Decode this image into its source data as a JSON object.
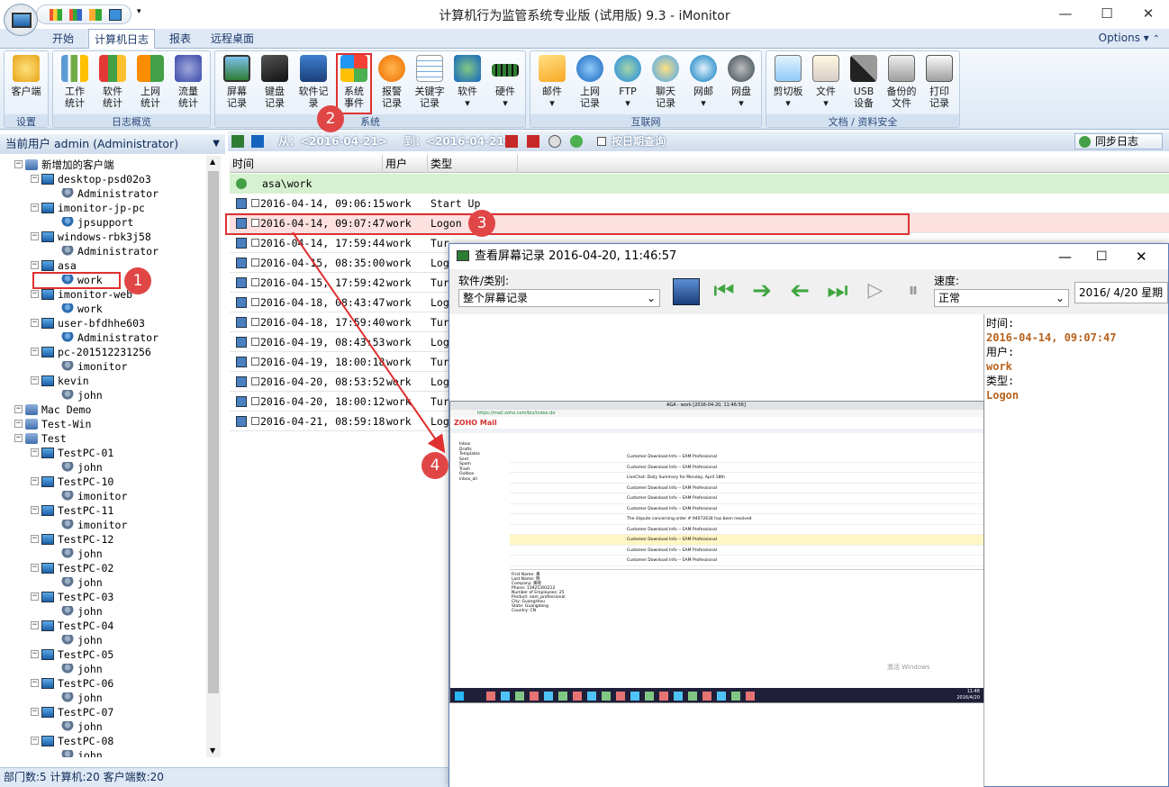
{
  "window": {
    "title": "计算机行为监管系统专业版 (试用版) 9.3 - iMonitor",
    "minimize": "—",
    "maximize": "☐",
    "close": "✕"
  },
  "qat": {
    "dropdown": "▾"
  },
  "ribbon_tabs": [
    {
      "label": "开始"
    },
    {
      "label": "计算机日志"
    },
    {
      "label": "报表"
    },
    {
      "label": "远程桌面"
    }
  ],
  "options_label": "Options",
  "ribbon_groups": [
    {
      "label": "设置",
      "buttons": [
        {
          "label": "客户端"
        }
      ]
    },
    {
      "label": "日志概览",
      "buttons": [
        {
          "label": "工作\n统计"
        },
        {
          "label": "软件\n统计"
        },
        {
          "label": "上网\n统计"
        },
        {
          "label": "流量\n统计"
        }
      ]
    },
    {
      "label": "系统",
      "buttons": [
        {
          "label": "屏幕\n记录"
        },
        {
          "label": "键盘\n记录"
        },
        {
          "label": "软件记录"
        },
        {
          "label": "系统\n事件"
        },
        {
          "label": "报警\n记录"
        },
        {
          "label": "关键字\n记录"
        },
        {
          "label": "软件"
        },
        {
          "label": "硬件"
        }
      ]
    },
    {
      "label": "互联网",
      "buttons": [
        {
          "label": "邮件"
        },
        {
          "label": "上网\n记录"
        },
        {
          "label": "FTP"
        },
        {
          "label": "聊天\n记录"
        },
        {
          "label": "网邮"
        },
        {
          "label": "网盘"
        }
      ]
    },
    {
      "label": "文档 / 资料安全",
      "buttons": [
        {
          "label": "剪切板"
        },
        {
          "label": "文件"
        },
        {
          "label": "USB\n设备"
        },
        {
          "label": "备份的\n文件"
        },
        {
          "label": "打印\n记录"
        }
      ]
    }
  ],
  "left_panel": {
    "current_user": "当前用户 admin (Administrator)",
    "tree": [
      {
        "label": "新增加的客户端",
        "type": "group",
        "level": 0
      },
      {
        "label": "desktop-psd02o3",
        "type": "pc",
        "level": 1
      },
      {
        "label": "Administrator",
        "type": "admin",
        "level": 2
      },
      {
        "label": "imonitor-jp-pc",
        "type": "pc",
        "level": 1
      },
      {
        "label": "jpsupport",
        "type": "user",
        "level": 2
      },
      {
        "label": "windows-rbk3j58",
        "type": "pc",
        "level": 1
      },
      {
        "label": "Administrator",
        "type": "admin",
        "level": 2
      },
      {
        "label": "asa",
        "type": "pc",
        "level": 1
      },
      {
        "label": "work",
        "type": "user",
        "level": 2
      },
      {
        "label": "imonitor-web",
        "type": "pc",
        "level": 1
      },
      {
        "label": "work",
        "type": "user",
        "level": 2
      },
      {
        "label": "user-bfdhhe603",
        "type": "pc",
        "level": 1
      },
      {
        "label": "Administrator",
        "type": "user",
        "level": 2
      },
      {
        "label": "pc-201512231256",
        "type": "pc",
        "level": 1
      },
      {
        "label": "imonitor",
        "type": "admin",
        "level": 2
      },
      {
        "label": "kevin",
        "type": "pc",
        "level": 1
      },
      {
        "label": "john",
        "type": "admin",
        "level": 2
      },
      {
        "label": "Mac Demo",
        "type": "group",
        "level": 0
      },
      {
        "label": "Test-Win",
        "type": "group",
        "level": 0
      },
      {
        "label": "Test",
        "type": "group",
        "level": 0
      },
      {
        "label": "TestPC-01",
        "type": "pc",
        "level": 1
      },
      {
        "label": "john",
        "type": "admin",
        "level": 2
      },
      {
        "label": "TestPC-10",
        "type": "pc",
        "level": 1
      },
      {
        "label": "imonitor",
        "type": "admin",
        "level": 2
      },
      {
        "label": "TestPC-11",
        "type": "pc",
        "level": 1
      },
      {
        "label": "imonitor",
        "type": "admin",
        "level": 2
      },
      {
        "label": "TestPC-12",
        "type": "pc",
        "level": 1
      },
      {
        "label": "john",
        "type": "admin",
        "level": 2
      },
      {
        "label": "TestPC-02",
        "type": "pc",
        "level": 1
      },
      {
        "label": "john",
        "type": "admin",
        "level": 2
      },
      {
        "label": "TestPC-03",
        "type": "pc",
        "level": 1
      },
      {
        "label": "john",
        "type": "admin",
        "level": 2
      },
      {
        "label": "TestPC-04",
        "type": "pc",
        "level": 1
      },
      {
        "label": "john",
        "type": "admin",
        "level": 2
      },
      {
        "label": "TestPC-05",
        "type": "pc",
        "level": 1
      },
      {
        "label": "john",
        "type": "admin",
        "level": 2
      },
      {
        "label": "TestPC-06",
        "type": "pc",
        "level": 1
      },
      {
        "label": "john",
        "type": "admin",
        "level": 2
      },
      {
        "label": "TestPC-07",
        "type": "pc",
        "level": 1
      },
      {
        "label": "john",
        "type": "admin",
        "level": 2
      },
      {
        "label": "TestPC-08",
        "type": "pc",
        "level": 1
      },
      {
        "label": "john",
        "type": "admin",
        "level": 2
      }
    ]
  },
  "status_bar": "部门数:5 计算机:20 客户端数:20",
  "main_toolbar": {
    "range_from": "从：<2016-04-21>",
    "range_to": "到：<2016-04-21>",
    "date_query": "按日期查询",
    "sync": "同步日志"
  },
  "columns": [
    {
      "label": "时间"
    },
    {
      "label": "用户"
    },
    {
      "label": "类型"
    }
  ],
  "group_row": "asa\\work",
  "rows": [
    {
      "time": "2016-04-14, 09:06:15",
      "user": "work",
      "type": "Start Up"
    },
    {
      "time": "2016-04-14, 09:07:47",
      "user": "work",
      "type": "Logon"
    },
    {
      "time": "2016-04-14, 17:59:44",
      "user": "work",
      "type": "Tur"
    },
    {
      "time": "2016-04-15, 08:35:00",
      "user": "work",
      "type": "Log"
    },
    {
      "time": "2016-04-15, 17:59:42",
      "user": "work",
      "type": "Tur"
    },
    {
      "time": "2016-04-18, 08:43:47",
      "user": "work",
      "type": "Log"
    },
    {
      "time": "2016-04-18, 17:59:40",
      "user": "work",
      "type": "Tur"
    },
    {
      "time": "2016-04-19, 08:43:53",
      "user": "work",
      "type": "Log"
    },
    {
      "time": "2016-04-19, 18:00:18",
      "user": "work",
      "type": "Tur"
    },
    {
      "time": "2016-04-20, 08:53:52",
      "user": "work",
      "type": "Log"
    },
    {
      "time": "2016-04-20, 18:00:12",
      "user": "work",
      "type": "Tur"
    },
    {
      "time": "2016-04-21, 08:59:18",
      "user": "work",
      "type": "Log"
    }
  ],
  "dialog": {
    "title": "查看屏幕记录 2016-04-20, 11:46:57",
    "software_label": "软件/类别:",
    "software_value": "整个屏幕记录",
    "speed_label": "速度:",
    "speed_value": "正常",
    "date_value": "2016/ 4/20 星期",
    "info": {
      "time_label": "时间:",
      "time_value": "2016-04-14, 09:07:47",
      "user_label": "用户:",
      "user_value": "work",
      "type_label": "类型:",
      "type_value": "Logon"
    },
    "screenshot": {
      "window_title": "AGA - work [2016-04-20, 11:46:56]",
      "url": "https://mail.zoho.com/biz/index.do",
      "logo": "ZOHO Mail",
      "folders": [
        "Inbox",
        "Drafts",
        "Templates",
        "Sent",
        "Spam",
        "Trash",
        "Outbox",
        "inbox_all"
      ],
      "mail_rows": [
        "Customer Download Info -- EAM Professional",
        "Customer Download Info -- EAM Professional",
        "LiveChat: Daily Summary for Monday, April 18th",
        "Customer Download Info -- EAM Professional",
        "Customer Download Info -- EAM Professional",
        "Customer Download Info -- EAM Professional",
        "The dispute concerning order # 94072634 has been resolved",
        "Customer Download Info -- EAM Professional",
        "Customer Download Info -- EAM Professional",
        "Customer Download Info -- EAM Professional",
        "Customer Download Info -- EAM Professional"
      ],
      "preview": "First Name: 黄\nLast Name: 晓\nCompany: 黄晓\nPhone: 13925393212\nNumber of Employees: 25\nProduct: eam_professional\nCity: Guangzhou\nState: Guangdong\nCountry: CN",
      "watermark": "激活 Windows",
      "clock": "11:46\n2016/4/20"
    }
  },
  "annotations": [
    {
      "label": "1"
    },
    {
      "label": "2"
    },
    {
      "label": "3"
    },
    {
      "label": "4"
    }
  ],
  "colors": {
    "accent": "#1d3a6b",
    "highlight": "#e03030",
    "group_row": "#d6f1d0",
    "info_value": "#b8621d"
  }
}
